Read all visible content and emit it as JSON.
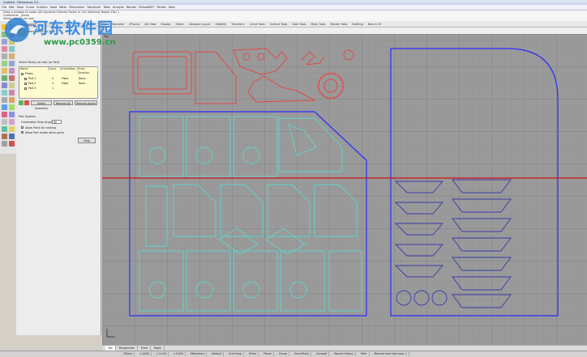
{
  "window": {
    "title": "Untitled - Rhinoceros 5.0"
  },
  "menu": [
    "File",
    "Edit",
    "View",
    "Curve",
    "Surface",
    "Solid",
    "Mesh",
    "Dimension",
    "Transform",
    "Tools",
    "Analyze",
    "Render",
    "RhinoNEST",
    "Panels",
    "Help"
  ],
  "command_history": [
    "Drag a window to zoom (All Dynamic Extents Factor In Out Selected Target 1To1 )",
    "Command: _Zoom",
    "Select objects to nest"
  ],
  "toolbar_tabs": [
    "Standard",
    "CPlanes",
    "Set View",
    "Display",
    "Select",
    "Viewport Layout",
    "Visibility",
    "Transform",
    "Curve Tools",
    "Surface Tools",
    "Solid Tools",
    "Mesh Tools",
    "Render Tools",
    "Drafting",
    "New in V5"
  ],
  "panel": {
    "title": "RhinoNEST",
    "select_label": "Select Part(s) to Nest",
    "list_label": "Select Part(s) to nest (or Part)",
    "tree_columns": [
      "Name",
      "Count",
      "Orientation",
      "Grain Direction"
    ],
    "tree_rows": [
      {
        "name": "Plates",
        "count": "",
        "orient": "",
        "grain": ""
      },
      {
        "name": "Part 1",
        "count": "4",
        "orient": "Fixed",
        "grain": "None"
      },
      {
        "name": "Part 2",
        "count": "4",
        "orient": "Fixed",
        "grain": "None"
      },
      {
        "name": "Part 3",
        "count": "1",
        "orient": "",
        "grain": ""
      }
    ],
    "buttons": {
      "select_geometry": "Select Geometry",
      "remove_all": "Remove All",
      "remove_active": "Remove Active"
    },
    "part_options_label": "Part Options",
    "orientation_step_label": "Orientation Step Angle",
    "orientation_step_value": "90",
    "opt_mirror": "Allow Parts for nesting",
    "opt_inside": "Allow Part inside other parts",
    "help_button": "Help"
  },
  "viewport": {
    "label": "Top"
  },
  "tabs": [
    "Top",
    "Perspective",
    "Front",
    "Right"
  ],
  "status": [
    "CPlane",
    "x 18.84",
    "y 14.54",
    "z 0.000",
    "Millimeters",
    "Default",
    "Grid Snap",
    "Ortho",
    "Planar",
    "Osnap",
    "SmartTrack",
    "Gumball",
    "Record History",
    "Filter",
    "Minutes from last save: 1"
  ],
  "watermark": {
    "text": "河东软件园",
    "url": "www.pc0359.cn"
  },
  "colors": {
    "red_parts": "#e04a4a",
    "blue_sheet": "#2b2bff",
    "cyan_nest": "#5ad7d0",
    "crosshair_red": "#d01010",
    "dark_parts": "#3a3aaa"
  }
}
